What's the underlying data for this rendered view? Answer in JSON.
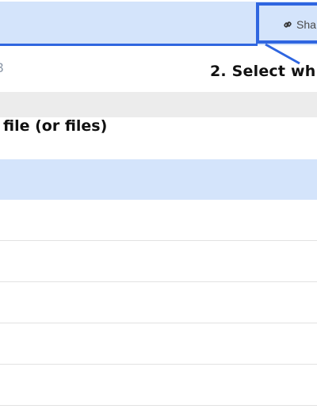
{
  "toolbar": {
    "share_label": "Sha",
    "accent_color": "#2f66e0",
    "band_color": "#d4e4fb"
  },
  "breadcrumb": {
    "partial_text": "3"
  },
  "callouts": {
    "step2": "2. Select wh",
    "step1_tail": "file (or files)"
  },
  "file_list": {
    "rows": [
      {},
      {},
      {},
      {},
      {}
    ]
  },
  "icons": {
    "share": "link-icon"
  }
}
